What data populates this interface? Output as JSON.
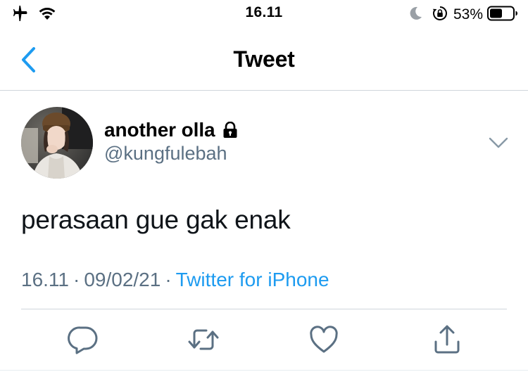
{
  "status_bar": {
    "time": "16.11",
    "battery_percent": "53%",
    "icons": [
      "airplane-icon",
      "wifi-icon",
      "moon-icon",
      "orientation-lock-icon",
      "battery-icon"
    ]
  },
  "nav": {
    "title": "Tweet",
    "back_icon": "chevron-left-icon"
  },
  "tweet": {
    "display_name": "another olla",
    "protected": true,
    "handle": "@kungfulebah",
    "text": "perasaan gue gak enak",
    "time": "16.11",
    "separator": "·",
    "date": "09/02/21",
    "source": "Twitter for iPhone"
  },
  "actions": [
    "reply-icon",
    "retweet-icon",
    "like-icon",
    "share-icon"
  ],
  "colors": {
    "accent": "#1d9bf0",
    "secondary_text": "#5b7083",
    "divider": "#cfd6db"
  }
}
